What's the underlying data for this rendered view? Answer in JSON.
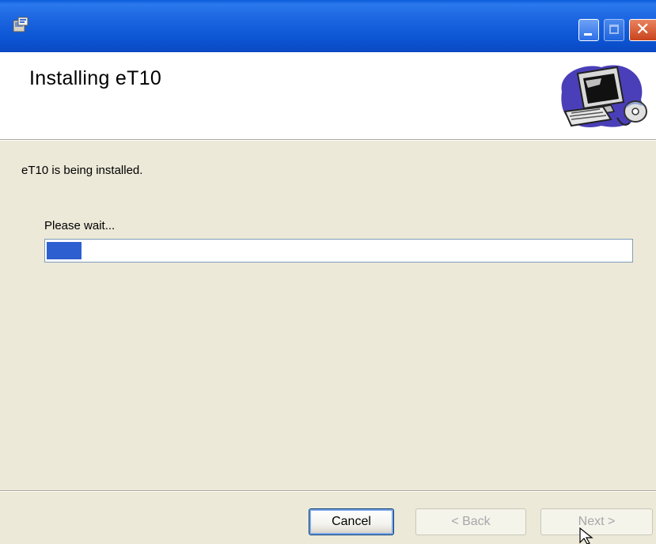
{
  "window": {
    "title": ""
  },
  "header": {
    "title": "Installing eT10"
  },
  "body": {
    "status": "eT10 is being installed.",
    "progress_label": "Please wait...",
    "progress_fraction": 0.06
  },
  "buttons": {
    "cancel": "Cancel",
    "back": "< Back",
    "next": "Next >"
  },
  "colors": {
    "titlebar": "#1a64e0",
    "progress_fill": "#2e5fd1",
    "dialog_bg": "#ece9d8"
  },
  "icons": [
    "installer-app-icon",
    "minimize-icon",
    "maximize-icon",
    "close-icon",
    "computer-cd-icon",
    "mouse-cursor-icon"
  ]
}
